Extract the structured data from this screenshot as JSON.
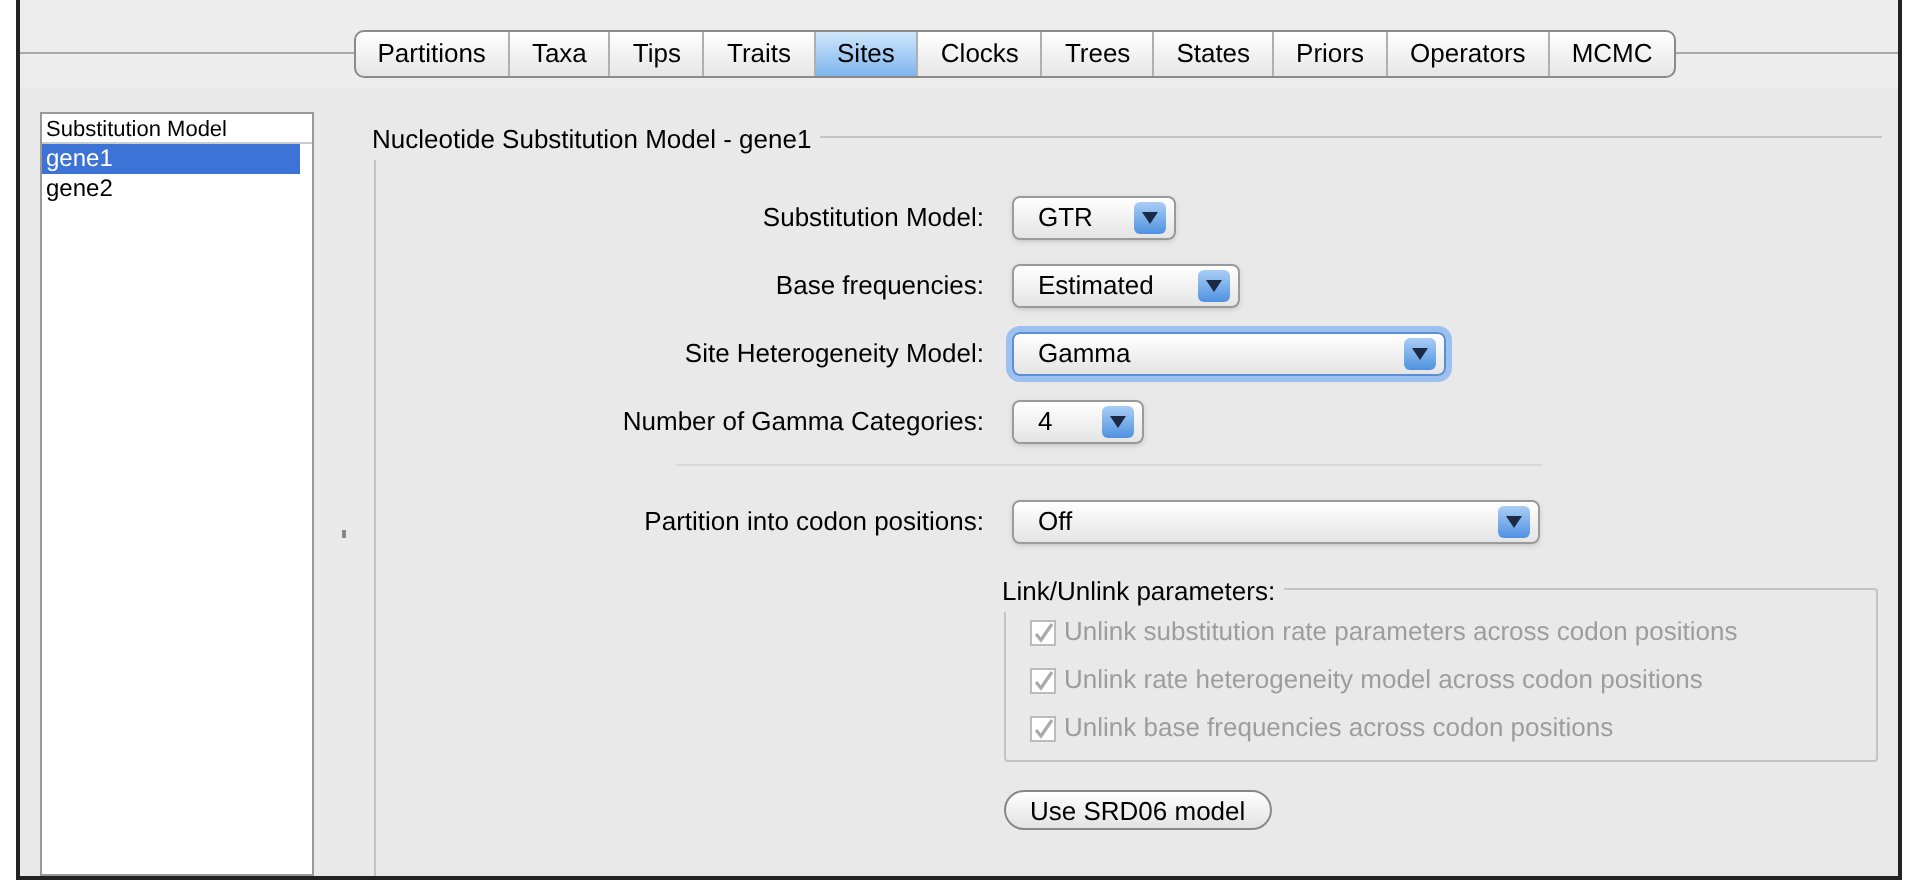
{
  "tabs": [
    {
      "label": "Partitions",
      "selected": false
    },
    {
      "label": "Taxa",
      "selected": false
    },
    {
      "label": "Tips",
      "selected": false
    },
    {
      "label": "Traits",
      "selected": false
    },
    {
      "label": "Sites",
      "selected": true
    },
    {
      "label": "Clocks",
      "selected": false
    },
    {
      "label": "Trees",
      "selected": false
    },
    {
      "label": "States",
      "selected": false
    },
    {
      "label": "Priors",
      "selected": false
    },
    {
      "label": "Operators",
      "selected": false
    },
    {
      "label": "MCMC",
      "selected": false
    }
  ],
  "sidebar": {
    "header": "Substitution Model",
    "items": [
      {
        "label": "gene1",
        "selected": true
      },
      {
        "label": "gene2",
        "selected": false
      }
    ]
  },
  "panel": {
    "title": "Nucleotide Substitution Model - gene1",
    "fields": [
      {
        "label": "Substitution Model:",
        "value": "GTR",
        "focused": false
      },
      {
        "label": "Base frequencies:",
        "value": "Estimated",
        "focused": false
      },
      {
        "label": "Site Heterogeneity Model:",
        "value": "Gamma",
        "focused": true
      },
      {
        "label": "Number of Gamma Categories:",
        "value": "4",
        "focused": false
      }
    ],
    "codon_field": {
      "label": "Partition into codon positions:",
      "value": "Off",
      "focused": false
    },
    "link_group": {
      "title": "Link/Unlink parameters:",
      "options": [
        {
          "label": "Unlink substitution rate parameters across codon positions",
          "checked": true,
          "disabled": true
        },
        {
          "label": "Unlink rate heterogeneity model across codon positions",
          "checked": true,
          "disabled": true
        },
        {
          "label": "Unlink base frequencies across codon positions",
          "checked": true,
          "disabled": true
        }
      ]
    },
    "button": "Use SRD06 model"
  }
}
